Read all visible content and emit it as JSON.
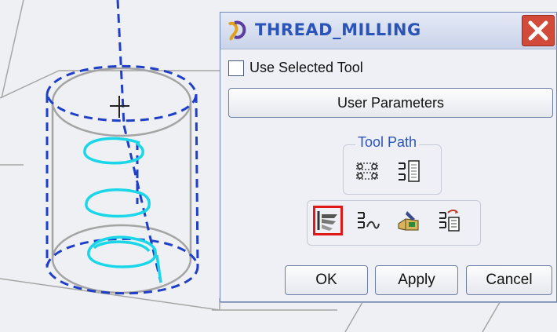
{
  "colors": {
    "accent": "#2b54b8",
    "helix": "#19d6e8",
    "dashed_path": "#1f3fc8",
    "wireframe": "#a0a0a0",
    "selected_outline": "#e01818",
    "close_button": "#d24a3a"
  },
  "dialog": {
    "title": "THREAD_MILLING",
    "app_icon": "app-logo-icon",
    "close_icon": "close-icon",
    "use_selected_tool": {
      "label": "Use Selected Tool",
      "checked": false
    },
    "user_parameters_label": "User Parameters",
    "tool_path": {
      "group_label": "Tool Path",
      "icons": [
        "tool-path-play-icon",
        "tool-path-list-icon"
      ]
    },
    "action_icons": [
      "machining-parameters-icon",
      "sequence-path-icon",
      "material-removal-icon",
      "sequence-info-icon"
    ],
    "selected_action_icon": "machining-parameters-icon",
    "buttons": {
      "ok": "OK",
      "apply": "Apply",
      "cancel": "Cancel"
    }
  }
}
